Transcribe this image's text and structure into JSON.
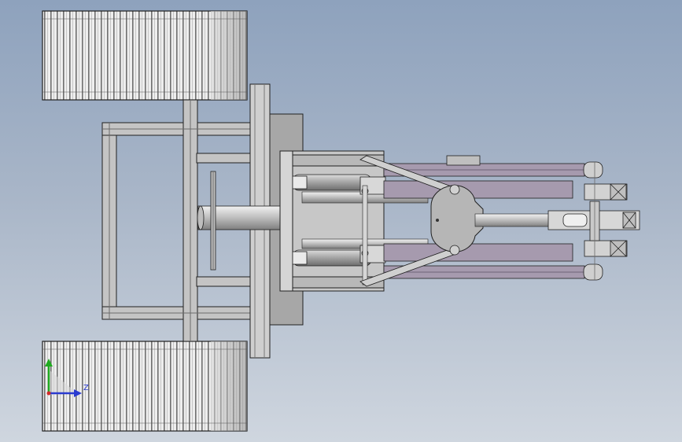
{
  "viewport": {
    "background_top": "#8ea2bd",
    "background_bottom": "#cfd6df"
  },
  "colors": {
    "outline": "#202020",
    "tread_light": "#eeeeee",
    "tread_dark": "#8c8c8c",
    "frame": "#c4c4c4",
    "plate": "#a7a7a7",
    "rod": "#d7d7d7",
    "cylinder": "#9b9bb0",
    "arm": "#a69aae",
    "hub": "#b6b6b6",
    "axis_y": "#1faa1f",
    "axis_z": "#2a3bd0",
    "axis_x": "#d02a2a"
  },
  "triad": {
    "label_z": "Z"
  },
  "parts": [
    "left-track-top",
    "left-track-bottom",
    "main-frame",
    "base-plate",
    "mount-plate",
    "main-shaft",
    "disc",
    "hydraulic-cylinder-upper",
    "hydraulic-cylinder-lower",
    "linkage-arm-upper",
    "linkage-arm-lower",
    "central-hub",
    "end-effector",
    "bearing-housing"
  ]
}
